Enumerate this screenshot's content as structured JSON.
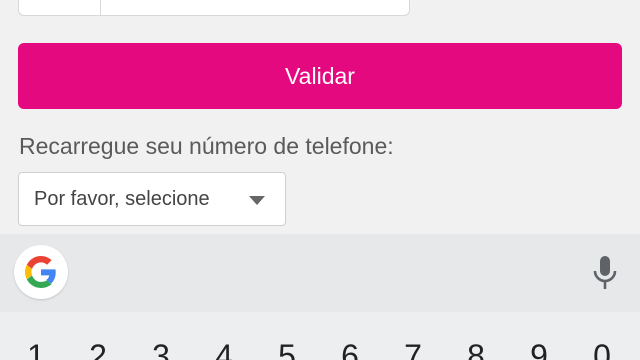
{
  "form": {
    "validate_label": "Validar",
    "recharge_label": "Recarregue seu número de telefone:",
    "select_value": "Por favor, selecione"
  },
  "keyboard": {
    "logo_icon": "google-g-icon",
    "mic_icon": "mic-icon",
    "number_keys": [
      "1",
      "2",
      "3",
      "4",
      "5",
      "6",
      "7",
      "8",
      "9",
      "0"
    ]
  },
  "colors": {
    "accent": "#e5097f",
    "background": "#f1f1f1"
  }
}
